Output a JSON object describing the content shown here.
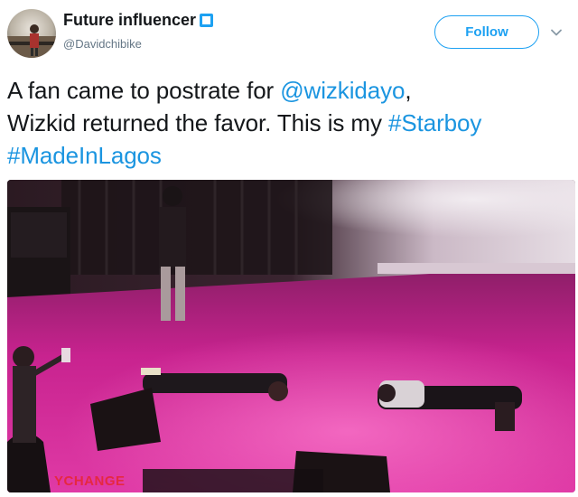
{
  "tweet": {
    "display_name": "Future influencer",
    "handle": "@Davidchibike",
    "follow_label": "Follow",
    "text_segments": [
      {
        "text": "A fan came to postrate for ",
        "type": "plain"
      },
      {
        "text": "@wizkidayo",
        "type": "mention"
      },
      {
        "text": ",",
        "type": "plain"
      },
      {
        "text": "Wizkid returned the favor. This is my ",
        "type": "plain"
      },
      {
        "text": "#Starboy",
        "type": "hashtag"
      },
      {
        "text": "#MadeInLagos",
        "type": "hashtag"
      }
    ],
    "media_watermark": "YCHANGE"
  },
  "colors": {
    "link_blue": "#1b95e0",
    "follow_blue": "#1da1f2",
    "handle_gray": "#657786",
    "stage_pink": "#d2279a"
  },
  "icons": {
    "verified": "verified-badge-icon",
    "caret": "chevron-down-icon"
  }
}
